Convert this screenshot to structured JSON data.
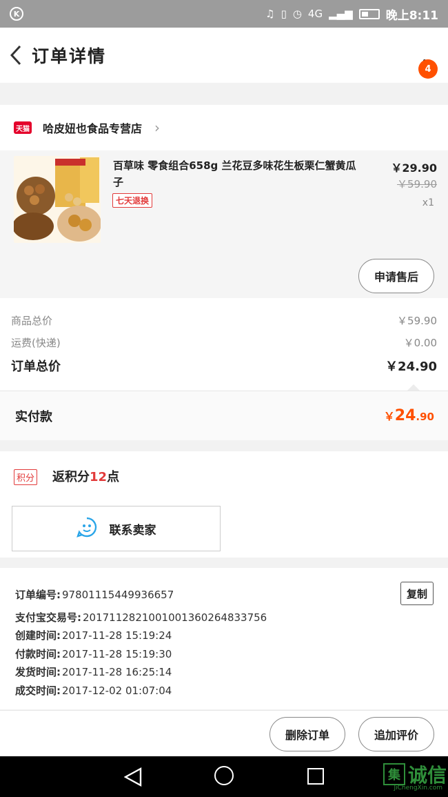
{
  "status_bar": {
    "network": "4G",
    "time": "晚上8:11"
  },
  "header": {
    "title": "订单详情",
    "badge_count": "4"
  },
  "shop": {
    "logo_text": "天猫",
    "name": "哈皮妞也食品专营店"
  },
  "product": {
    "title": "百草味 零食组合658g 兰花豆多味花生板栗仁蟹黄瓜子",
    "tag": "七天退换",
    "price": "￥29.90",
    "original_price": "￥59.90",
    "quantity": "x1",
    "after_sale_label": "申请售后"
  },
  "totals": {
    "goods_label": "商品总价",
    "goods_value": "￥59.90",
    "shipping_label": "运费(快递)",
    "shipping_value": "￥0.00",
    "order_total_label": "订单总价",
    "order_total_value": "￥24.90",
    "paid_label": "实付款",
    "paid_symbol": "￥",
    "paid_int": "24",
    "paid_dec": ".90"
  },
  "points": {
    "tag": "积分",
    "text_prefix": "返积分",
    "count": "12",
    "text_suffix": "点"
  },
  "contact": {
    "label": "联系卖家"
  },
  "order_info": {
    "copy_label": "复制",
    "lines": [
      {
        "label": "订单编号:",
        "value": "97801115449936657"
      },
      {
        "label": "支付宝交易号:",
        "value": "2017112821001001360264833756"
      },
      {
        "label": "创建时间:",
        "value": "2017-11-28 15:19:24"
      },
      {
        "label": "付款时间:",
        "value": "2017-11-28 15:19:30"
      },
      {
        "label": "发货时间:",
        "value": "2017-11-28 16:25:14"
      },
      {
        "label": "成交时间:",
        "value": "2017-12-02 01:07:04"
      }
    ]
  },
  "actions": {
    "delete_label": "删除订单",
    "review_label": "追加评价"
  },
  "watermark": {
    "box": "集",
    "text": "诚信",
    "url": "JiChengXin.com"
  },
  "colors": {
    "accent": "#ff5000",
    "tmall_red": "#e4002b",
    "tag_red": "#e23a3a",
    "icon_blue": "#2aa5e8"
  }
}
